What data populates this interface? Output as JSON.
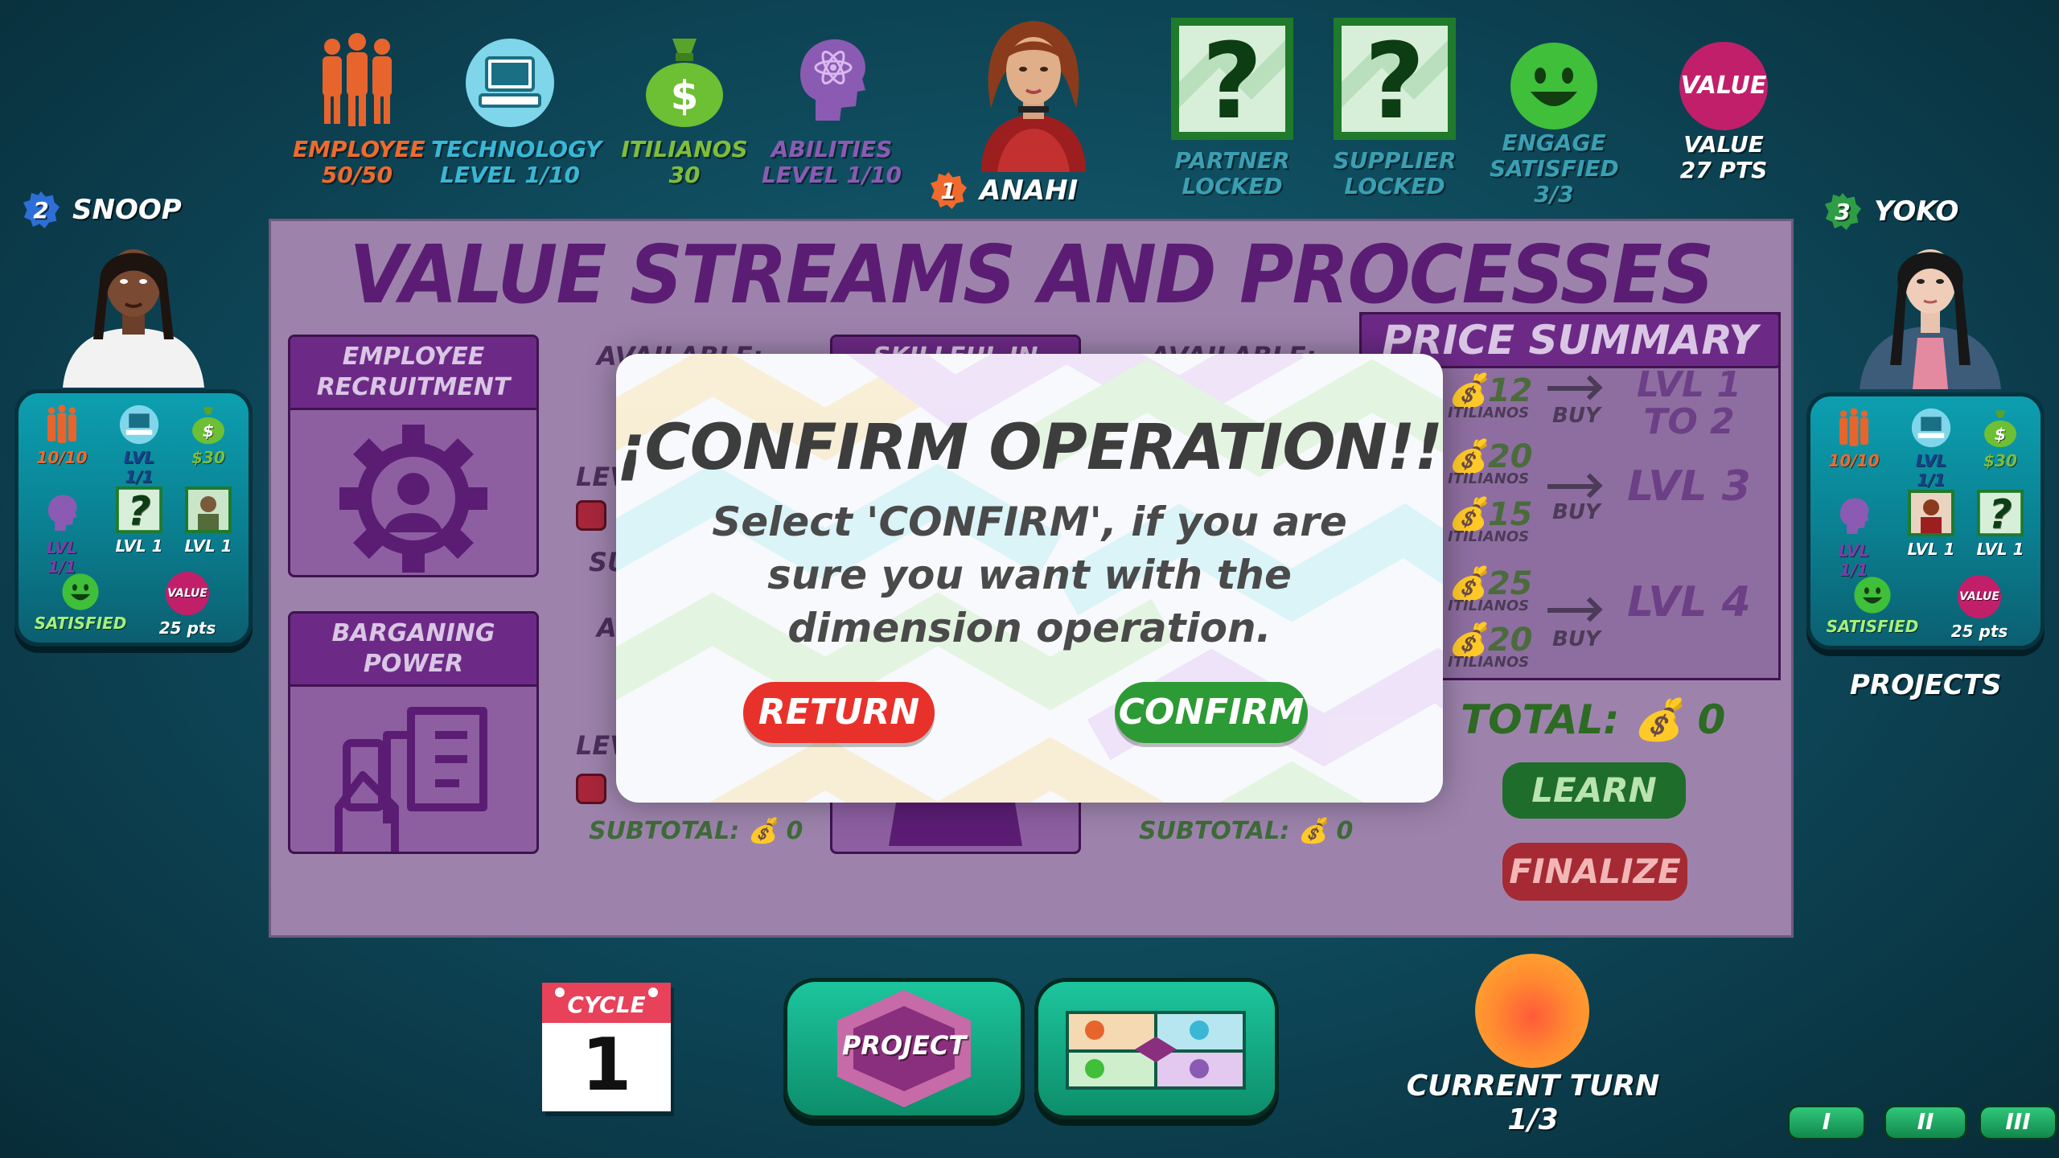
{
  "top_stats": {
    "employee": {
      "label": "EMPLOYEE",
      "value": "50/50",
      "color": "#f06a2e",
      "icon": "employees-icon"
    },
    "technology": {
      "label": "TECHNOLOGY",
      "value": "LEVEL 1/10",
      "color": "#3ab7d6",
      "icon": "computer-icon"
    },
    "itilianos": {
      "label": "ITILIANOS",
      "value": "30",
      "color": "#7fbd3b",
      "icon": "money-bag-icon"
    },
    "abilities": {
      "label": "ABILITIES",
      "value": "LEVEL 1/10",
      "color": "#8b5bb3",
      "icon": "head-atom-icon"
    },
    "partner": {
      "label": "PARTNER",
      "value": "LOCKED",
      "color": "#3b9fb2",
      "icon": "question-card-icon"
    },
    "supplier": {
      "label": "SUPPLIER",
      "value": "LOCKED",
      "color": "#3b9fb2",
      "icon": "question-card-icon"
    },
    "engage": {
      "label": "ENGAGE",
      "label2": "SATISFIED",
      "value": "3/3",
      "color": "#3b9fb2",
      "icon": "smiley-icon"
    },
    "value": {
      "badge": "VALUE",
      "label": "VALUE",
      "value": "27 PTS",
      "icon": "value-badge-icon"
    }
  },
  "current_player": {
    "number": "1",
    "name": "ANAHI"
  },
  "players": {
    "left": {
      "number": "2",
      "name": "SNOOP",
      "stats": {
        "employees": "10/10",
        "tech": "LVL 1/1",
        "money": "$30",
        "abilities": "LVL 1/1",
        "partner": "LVL 1",
        "supplier": "LVL 1",
        "engage": "SATISFIED",
        "value_badge": "VALUE",
        "value": "25 pts"
      }
    },
    "right": {
      "number": "3",
      "name": "YOKO",
      "stats": {
        "employees": "10/10",
        "tech": "LVL 1/1",
        "money": "$30",
        "abilities": "LVL 1/1",
        "partner": "LVL 1",
        "supplier": "LVL 1",
        "engage": "SATISFIED",
        "value_badge": "VALUE",
        "value": "25 pts"
      },
      "projects_label": "PROJECTS"
    }
  },
  "panel": {
    "title": "VALUE STREAMS AND PROCESSES",
    "cards": [
      {
        "title_line1": "EMPLOYEE",
        "title_line2": "RECRUITMENT",
        "icon": "gear-person-icon"
      },
      {
        "title_line1": "BARGANING",
        "title_line2": "POWER",
        "icon": "hand-money-icon"
      },
      {
        "title": "SKILLFUL IN",
        "icon": "person-icon"
      }
    ],
    "faded": {
      "available1": "AVAILABLE:",
      "available2": "AVAILABLE:",
      "lev1": "LEV",
      "lev2": "LEV",
      "su": "SU",
      "a": "A",
      "subtotal1": "SUBTOTAL:",
      "subtotal1_value": "0",
      "subtotal2": "SUBTOTAL:",
      "subtotal2_value": "0"
    },
    "price_summary": {
      "title": "PRICE SUMMARY",
      "rows": [
        {
          "cost": "12",
          "currency": "ITILIANOS",
          "action": "BUY",
          "level": "LVL 1 TO 2"
        },
        {
          "cost": "20",
          "currency": "ITILIANOS"
        },
        {
          "cost": "15",
          "currency": "ITILIANOS",
          "action": "BUY",
          "level": "LVL 3"
        },
        {
          "cost": "25",
          "currency": "ITILIANOS"
        },
        {
          "cost": "20",
          "currency": "ITILIANOS",
          "action": "BUY",
          "level": "LVL 4"
        }
      ],
      "total_label": "TOTAL:",
      "total_value": "0"
    },
    "buttons": {
      "learn": "LEARN",
      "finalize": "FINALIZE"
    }
  },
  "modal": {
    "title": "¡CONFIRM OPERATION!!",
    "message": "Select 'CONFIRM', if you are sure you want with the dimension operation.",
    "return_label": "RETURN",
    "confirm_label": "CONFIRM"
  },
  "bottom": {
    "cycle_label": "CYCLE",
    "cycle_value": "1",
    "project_label": "PROJECT",
    "board_icon": "board-map-icon",
    "current_turn_label": "CURRENT TURN",
    "current_turn_value": "1/3",
    "page_buttons": [
      "I",
      "II",
      "III"
    ]
  }
}
